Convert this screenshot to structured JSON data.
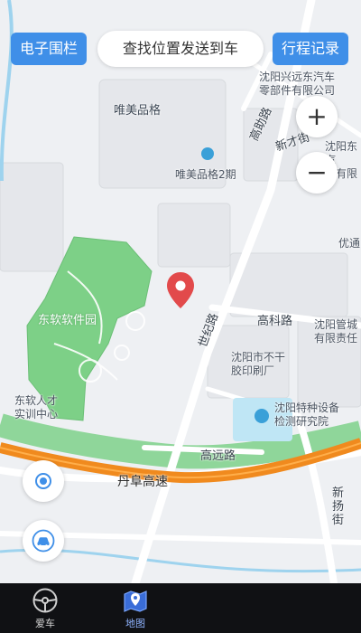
{
  "top_bar": {
    "geofence_label": "电子围栏",
    "search_label": "查找位置发送到车",
    "trip_record_label": "行程记录"
  },
  "zoom": {
    "in_symbol": "+",
    "out_symbol": "−"
  },
  "map": {
    "pin_icon": "location-pin-icon",
    "pin_color": "#e24a4b",
    "labels": {
      "weimei": "唯美品格",
      "weimei2": "唯美品格2期",
      "xingyuan": "沈阳兴远东汽车\n零部件有限公司",
      "gaodalu": "高助路",
      "xincaijie": "新才街",
      "shenyangdong": "沈阳东汽\n业有限",
      "youxuan": "优通",
      "neusoft_park": "东软软件园",
      "shijilu": "世纪路",
      "gaokelu": "高科路",
      "guancheng": "沈阳管城\n有限责任",
      "bugan": "沈阳市不干\n胶印刷厂",
      "training": "东软人才\n实训中心",
      "tezhong": "沈阳特种设备\n检测研究院",
      "gaoyuanlu": "高远路",
      "danfu": "丹阜高速",
      "xinyangjie": "新\n扬\n街"
    }
  },
  "tabs": [
    {
      "label": "爱车",
      "icon": "steering-wheel-icon"
    },
    {
      "label": "地图",
      "icon": "map-icon"
    }
  ],
  "colors": {
    "accent": "#3f8fe8",
    "highway": "#f08a1e",
    "greenspace": "#7dd087",
    "water": "#bfe6f5",
    "tabbar": "#101114"
  }
}
